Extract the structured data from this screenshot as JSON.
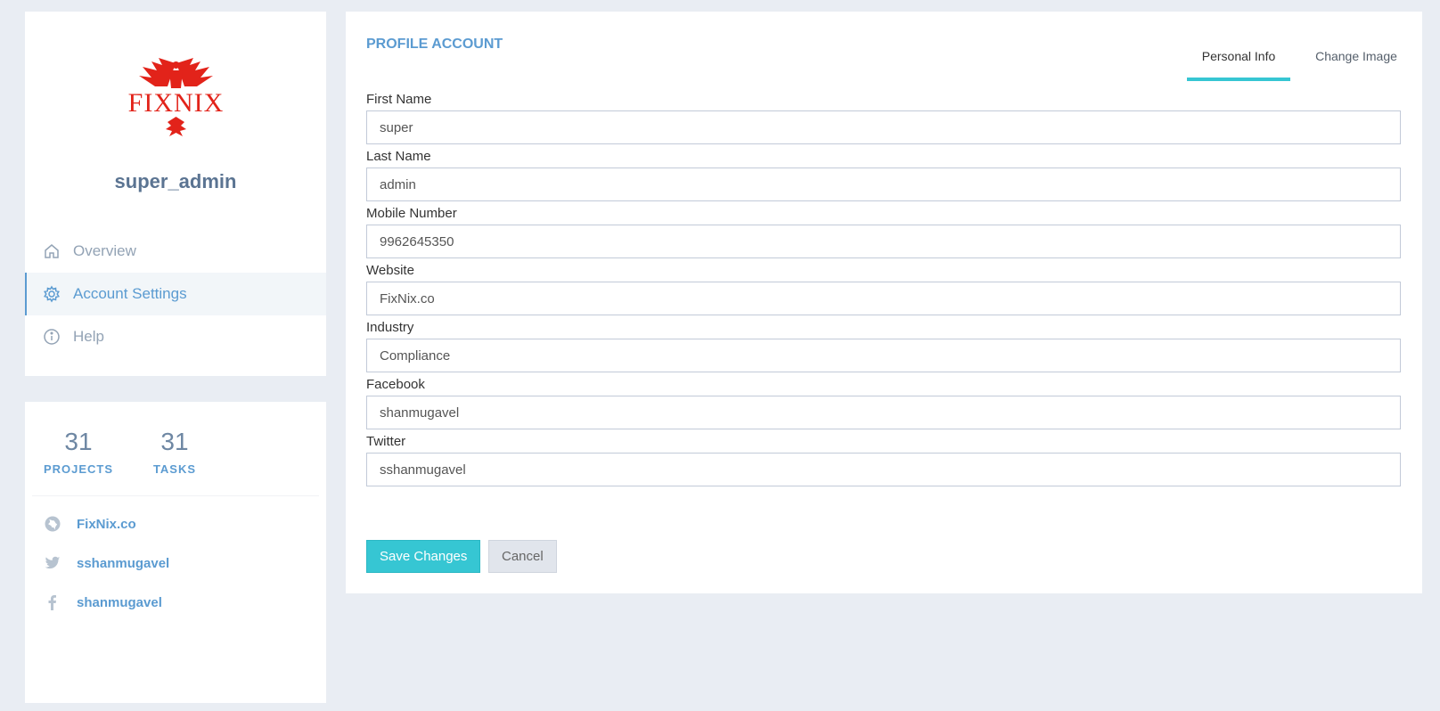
{
  "profile": {
    "username": "super_admin",
    "logo_text": "FIXNIX",
    "brand_color": "#e2231a"
  },
  "nav": {
    "items": [
      {
        "label": "Overview",
        "icon": "home-icon",
        "active": false
      },
      {
        "label": "Account Settings",
        "icon": "gear-icon",
        "active": true
      },
      {
        "label": "Help",
        "icon": "info-icon",
        "active": false
      }
    ]
  },
  "stats": {
    "projects": {
      "value": "31",
      "label": "PROJECTS"
    },
    "tasks": {
      "value": "31",
      "label": "TASKS"
    }
  },
  "links": [
    {
      "label": "FixNix.co",
      "icon": "globe-icon"
    },
    {
      "label": "sshanmugavel",
      "icon": "twitter-icon"
    },
    {
      "label": "shanmugavel",
      "icon": "facebook-icon"
    }
  ],
  "main": {
    "title": "PROFILE ACCOUNT",
    "tabs": [
      {
        "label": "Personal Info",
        "active": true
      },
      {
        "label": "Change Image",
        "active": false
      }
    ],
    "fields": {
      "first_name": {
        "label": "First Name",
        "value": "super"
      },
      "last_name": {
        "label": "Last Name",
        "value": "admin"
      },
      "mobile": {
        "label": "Mobile Number",
        "value": "9962645350"
      },
      "website": {
        "label": "Website",
        "value": "FixNix.co"
      },
      "industry": {
        "label": "Industry",
        "value": "Compliance"
      },
      "facebook": {
        "label": "Facebook",
        "value": "shanmugavel"
      },
      "twitter": {
        "label": "Twitter",
        "value": "sshanmugavel"
      }
    },
    "buttons": {
      "save": "Save Changes",
      "cancel": "Cancel"
    }
  },
  "colors": {
    "accent": "#5b9bd1",
    "primary_button": "#36c6d3",
    "background": "#e9edf3"
  }
}
